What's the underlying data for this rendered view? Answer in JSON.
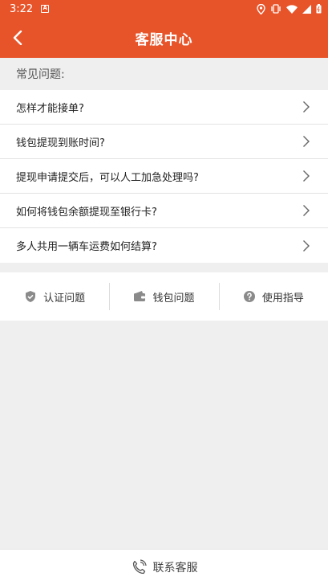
{
  "status_bar": {
    "time": "3:22",
    "icons": [
      "a-notification-icon",
      "location-icon",
      "vibrate-icon",
      "wifi-icon",
      "signal-icon",
      "battery-icon"
    ]
  },
  "header": {
    "title": "客服中心",
    "back_icon": "back-arrow-icon"
  },
  "faq": {
    "section_title": "常见问题:",
    "items": [
      {
        "label": "怎样才能接单?"
      },
      {
        "label": "钱包提现到账时间?"
      },
      {
        "label": "提现申请提交后，可以人工加急处理吗?"
      },
      {
        "label": "如何将钱包余额提现至银行卡?"
      },
      {
        "label": "多人共用一辆车运费如何结算?"
      }
    ]
  },
  "categories": [
    {
      "label": "认证问题",
      "icon": "shield-check-icon"
    },
    {
      "label": "钱包问题",
      "icon": "wallet-icon"
    },
    {
      "label": "使用指导",
      "icon": "help-circle-icon"
    }
  ],
  "bottom": {
    "label": "联系客服",
    "icon": "phone-icon"
  },
  "colors": {
    "brand": "#e8542a",
    "background": "#efefef",
    "icon_gray": "#8a8a8a"
  }
}
